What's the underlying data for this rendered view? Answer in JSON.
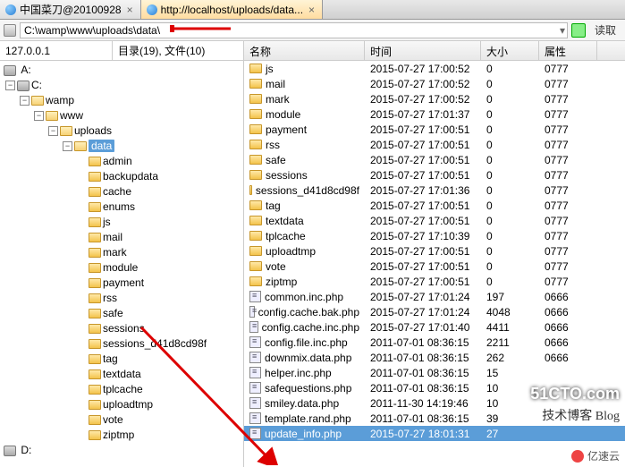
{
  "tabs": [
    {
      "label": "中国菜刀@20100928",
      "active": false
    },
    {
      "label": "http://localhost/uploads/data...",
      "active": true
    }
  ],
  "address_path": "C:\\wamp\\www\\uploads\\data\\",
  "read_button": "读取",
  "ip_label": "127.0.0.1",
  "dir_summary": "目录(19), 文件(10)",
  "columns": {
    "name": "名称",
    "time": "时间",
    "size": "大小",
    "attr": "属性"
  },
  "drives": [
    "A:",
    "C:",
    "D:"
  ],
  "tree": {
    "root": "C:",
    "l1": "wamp",
    "l2": "www",
    "l3": "uploads",
    "l4_selected": "data",
    "data_children": [
      "admin",
      "backupdata",
      "cache",
      "enums",
      "js",
      "mail",
      "mark",
      "module",
      "payment",
      "rss",
      "safe",
      "sessions",
      "sessions_d41d8cd98f",
      "tag",
      "textdata",
      "tplcache",
      "uploadtmp",
      "vote",
      "ziptmp"
    ]
  },
  "files": [
    {
      "name": "js",
      "type": "folder",
      "time": "2015-07-27 17:00:52",
      "size": "0",
      "attr": "0777"
    },
    {
      "name": "mail",
      "type": "folder",
      "time": "2015-07-27 17:00:52",
      "size": "0",
      "attr": "0777"
    },
    {
      "name": "mark",
      "type": "folder",
      "time": "2015-07-27 17:00:52",
      "size": "0",
      "attr": "0777"
    },
    {
      "name": "module",
      "type": "folder",
      "time": "2015-07-27 17:01:37",
      "size": "0",
      "attr": "0777"
    },
    {
      "name": "payment",
      "type": "folder",
      "time": "2015-07-27 17:00:51",
      "size": "0",
      "attr": "0777"
    },
    {
      "name": "rss",
      "type": "folder",
      "time": "2015-07-27 17:00:51",
      "size": "0",
      "attr": "0777"
    },
    {
      "name": "safe",
      "type": "folder",
      "time": "2015-07-27 17:00:51",
      "size": "0",
      "attr": "0777"
    },
    {
      "name": "sessions",
      "type": "folder",
      "time": "2015-07-27 17:00:51",
      "size": "0",
      "attr": "0777"
    },
    {
      "name": "sessions_d41d8cd98f",
      "type": "folder",
      "time": "2015-07-27 17:01:36",
      "size": "0",
      "attr": "0777"
    },
    {
      "name": "tag",
      "type": "folder",
      "time": "2015-07-27 17:00:51",
      "size": "0",
      "attr": "0777"
    },
    {
      "name": "textdata",
      "type": "folder",
      "time": "2015-07-27 17:00:51",
      "size": "0",
      "attr": "0777"
    },
    {
      "name": "tplcache",
      "type": "folder",
      "time": "2015-07-27 17:10:39",
      "size": "0",
      "attr": "0777"
    },
    {
      "name": "uploadtmp",
      "type": "folder",
      "time": "2015-07-27 17:00:51",
      "size": "0",
      "attr": "0777"
    },
    {
      "name": "vote",
      "type": "folder",
      "time": "2015-07-27 17:00:51",
      "size": "0",
      "attr": "0777"
    },
    {
      "name": "ziptmp",
      "type": "folder",
      "time": "2015-07-27 17:00:51",
      "size": "0",
      "attr": "0777"
    },
    {
      "name": "common.inc.php",
      "type": "php",
      "time": "2015-07-27 17:01:24",
      "size": "197",
      "attr": "0666"
    },
    {
      "name": "config.cache.bak.php",
      "type": "php",
      "time": "2015-07-27 17:01:24",
      "size": "4048",
      "attr": "0666"
    },
    {
      "name": "config.cache.inc.php",
      "type": "php",
      "time": "2015-07-27 17:01:40",
      "size": "4411",
      "attr": "0666"
    },
    {
      "name": "config.file.inc.php",
      "type": "php",
      "time": "2011-07-01 08:36:15",
      "size": "2211",
      "attr": "0666"
    },
    {
      "name": "downmix.data.php",
      "type": "php",
      "time": "2011-07-01 08:36:15",
      "size": "262",
      "attr": "0666"
    },
    {
      "name": "helper.inc.php",
      "type": "php",
      "time": "2011-07-01 08:36:15",
      "size": "15",
      "attr": ""
    },
    {
      "name": "safequestions.php",
      "type": "php",
      "time": "2011-07-01 08:36:15",
      "size": "10",
      "attr": ""
    },
    {
      "name": "smiley.data.php",
      "type": "php",
      "time": "2011-11-30 14:19:46",
      "size": "10",
      "attr": ""
    },
    {
      "name": "template.rand.php",
      "type": "php",
      "time": "2011-07-01 08:36:15",
      "size": "39",
      "attr": ""
    },
    {
      "name": "update_info.php",
      "type": "php",
      "time": "2015-07-27 18:01:31",
      "size": "27",
      "attr": "",
      "selected": true
    }
  ],
  "watermarks": {
    "w1": "51CTO.com",
    "w2": "技术博客   Blog",
    "w3": "亿速云"
  }
}
